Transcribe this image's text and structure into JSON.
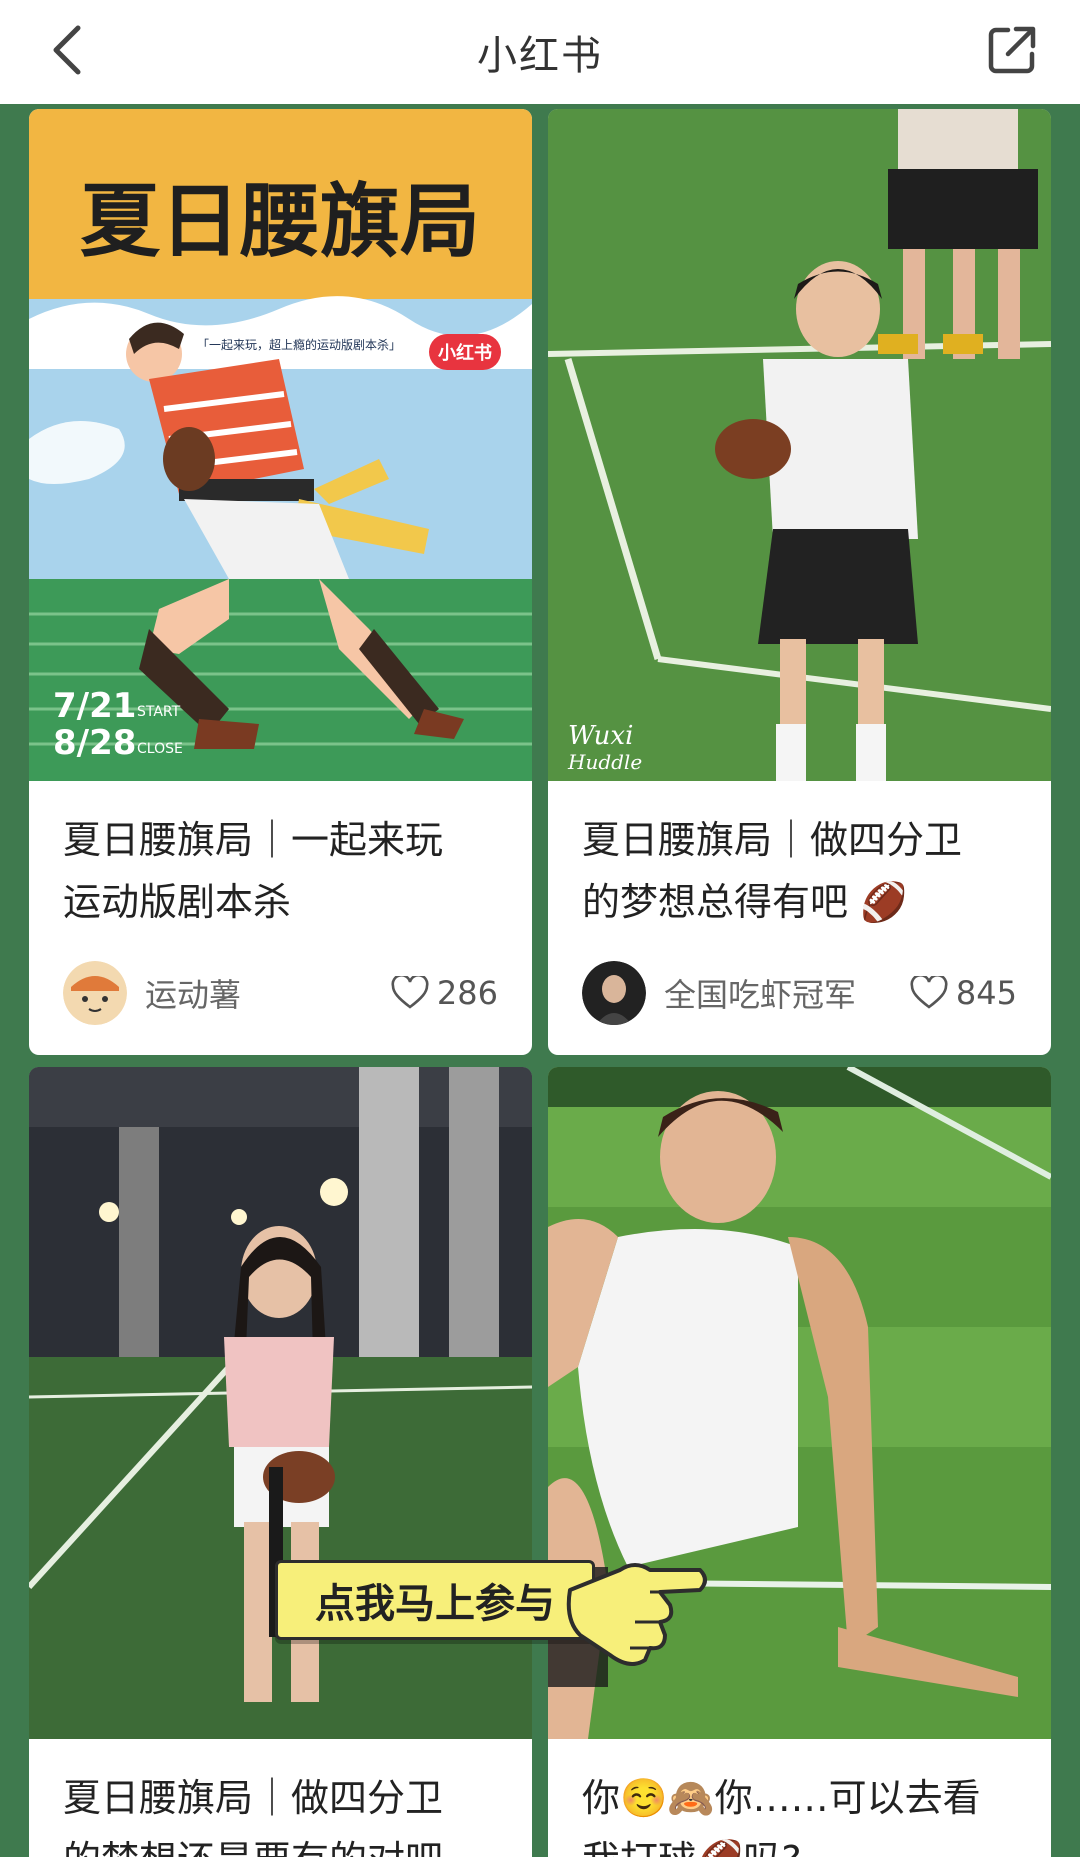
{
  "topbar": {
    "title": "小红书",
    "back_icon": "chevron-left-icon",
    "share_icon": "external-link-icon"
  },
  "theme": {
    "feed_background": "#3f7a4e",
    "card_background": "#ffffff",
    "brand_red": "#e8343f"
  },
  "cards": [
    {
      "poster_title": "夏日腰旗局",
      "poster_subtitle": "「一起来玩，超上瘾的运动版剧本杀」",
      "poster_brand": "小红书",
      "poster_start_date": "7/21",
      "poster_start_label": "START",
      "poster_close_date": "8/28",
      "poster_close_label": "CLOSE",
      "title_line1": "夏日腰旗局｜一起来玩",
      "title_line2": "运动版剧本杀",
      "author": "运动薯",
      "likes": "286"
    },
    {
      "watermark_line1": "Wuxi",
      "watermark_line2": "Huddle",
      "title_line1": "夏日腰旗局｜做四分卫",
      "title_line2": "的梦想总得有吧 🏈",
      "author": "全国吃虾冠军",
      "likes": "845"
    },
    {
      "title_line1": "夏日腰旗局｜做四分卫",
      "title_line2": "的梦想还是要有的对吧"
    },
    {
      "title_line1": "你☺️🙈你……可以去看",
      "title_line2": "我打球🏈吗?"
    }
  ],
  "cta": {
    "label": "点我马上参与"
  }
}
